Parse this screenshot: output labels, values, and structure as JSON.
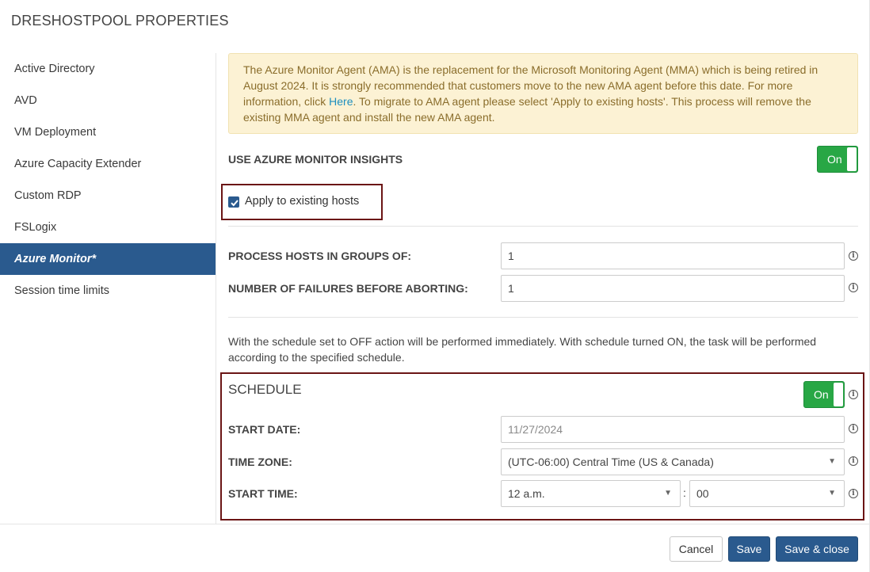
{
  "dialog": {
    "title": "DRESHOSTPOOL PROPERTIES"
  },
  "sidebar": {
    "items": [
      {
        "label": "Active Directory"
      },
      {
        "label": "AVD"
      },
      {
        "label": "VM Deployment"
      },
      {
        "label": "Azure Capacity Extender"
      },
      {
        "label": "Custom RDP"
      },
      {
        "label": "FSLogix"
      },
      {
        "label": "Azure Monitor*"
      },
      {
        "label": "Session time limits"
      }
    ],
    "active_index": 6
  },
  "alert": {
    "text_before_link": "The Azure Monitor Agent (AMA) is the replacement for the Microsoft Monitoring Agent (MMA) which is being retired in August 2024. It is strongly recommended that customers move to the new AMA agent before this date. For more information, click ",
    "link_text": "Here",
    "text_after_link": ". To migrate to AMA agent please select 'Apply to existing hosts'. This process will remove the existing MMA agent and install the new AMA agent."
  },
  "insights": {
    "label": "USE AZURE MONITOR INSIGHTS",
    "toggle_label": "On"
  },
  "apply_existing": {
    "label": "Apply to existing hosts",
    "checked": true
  },
  "process_groups": {
    "label": "PROCESS HOSTS IN GROUPS OF:",
    "value": "1"
  },
  "failures": {
    "label": "NUMBER OF FAILURES BEFORE ABORTING:",
    "value": "1"
  },
  "schedule_note": "With the schedule set to OFF action will be performed immediately. With schedule turned ON, the task will be performed according to the specified schedule.",
  "schedule": {
    "title": "SCHEDULE",
    "toggle_label": "On",
    "start_date": {
      "label": "START DATE:",
      "placeholder": "11/27/2024"
    },
    "time_zone": {
      "label": "TIME ZONE:",
      "value": "(UTC-06:00) Central Time (US & Canada)"
    },
    "start_time": {
      "label": "START TIME:",
      "hour": "12 a.m.",
      "separator": ":",
      "minute": "00"
    }
  },
  "footer": {
    "cancel": "Cancel",
    "save": "Save",
    "save_close": "Save & close"
  },
  "colors": {
    "primary": "#2a5a8e",
    "toggle_on": "#28a745",
    "alert_bg": "#fcf2d4",
    "highlight_border": "#6b1515"
  }
}
